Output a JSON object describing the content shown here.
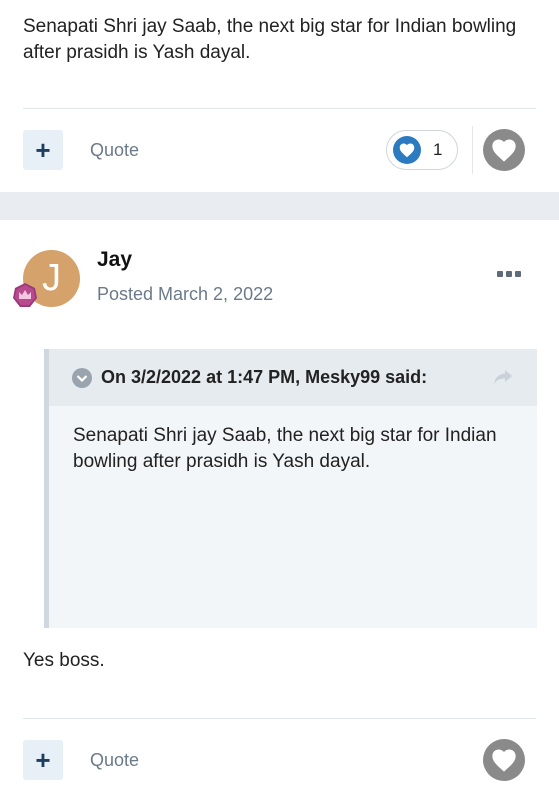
{
  "post1": {
    "body": "Senapati Shri jay Saab, the next big star for Indian bowling after prasidh is Yash dayal.",
    "actions": {
      "add_label": "+",
      "quote_label": "Quote"
    },
    "reaction": {
      "icon": "heart-icon",
      "count": "1",
      "color": "#2c7bc0"
    }
  },
  "post2": {
    "author": "Jay",
    "avatar_letter": "J",
    "avatar_color": "#d4a26a",
    "posted": "Posted March 2, 2022",
    "quote": {
      "header": "On 3/2/2022 at 1:47 PM, Mesky99 said:",
      "body": "Senapati Shri jay Saab, the next big star for Indian bowling after prasidh is Yash dayal."
    },
    "body": "Yes boss.",
    "actions": {
      "add_label": "+",
      "quote_label": "Quote"
    }
  }
}
